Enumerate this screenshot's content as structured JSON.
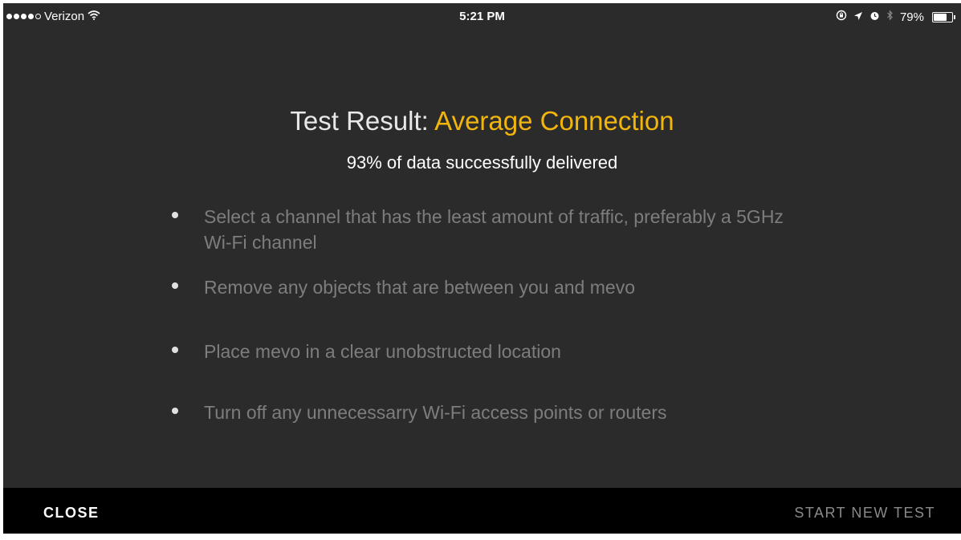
{
  "status_bar": {
    "carrier": "Verizon",
    "time": "5:21 PM",
    "battery": "79%",
    "battery_level": 0.79,
    "signal_bars_filled": 4,
    "signal_bars_total": 5,
    "icons": [
      "wifi-icon",
      "orientation-lock-icon",
      "location-icon",
      "alarm-icon",
      "bluetooth-icon",
      "battery-icon"
    ]
  },
  "result": {
    "label": "Test Result:",
    "status": "Average Connection",
    "status_color": "#f2b50c",
    "delivered": "93%  of data successfully delivered"
  },
  "tips": [
    "Select a channel that has the least amount of traffic, preferably a 5GHz Wi-Fi channel",
    "Remove any objects that are between you and mevo",
    "Place mevo in a clear unobstructed location",
    "Turn off any unnecessarry Wi-Fi access points or routers"
  ],
  "actions": {
    "close": "CLOSE",
    "start_new_test": "START NEW TEST"
  }
}
